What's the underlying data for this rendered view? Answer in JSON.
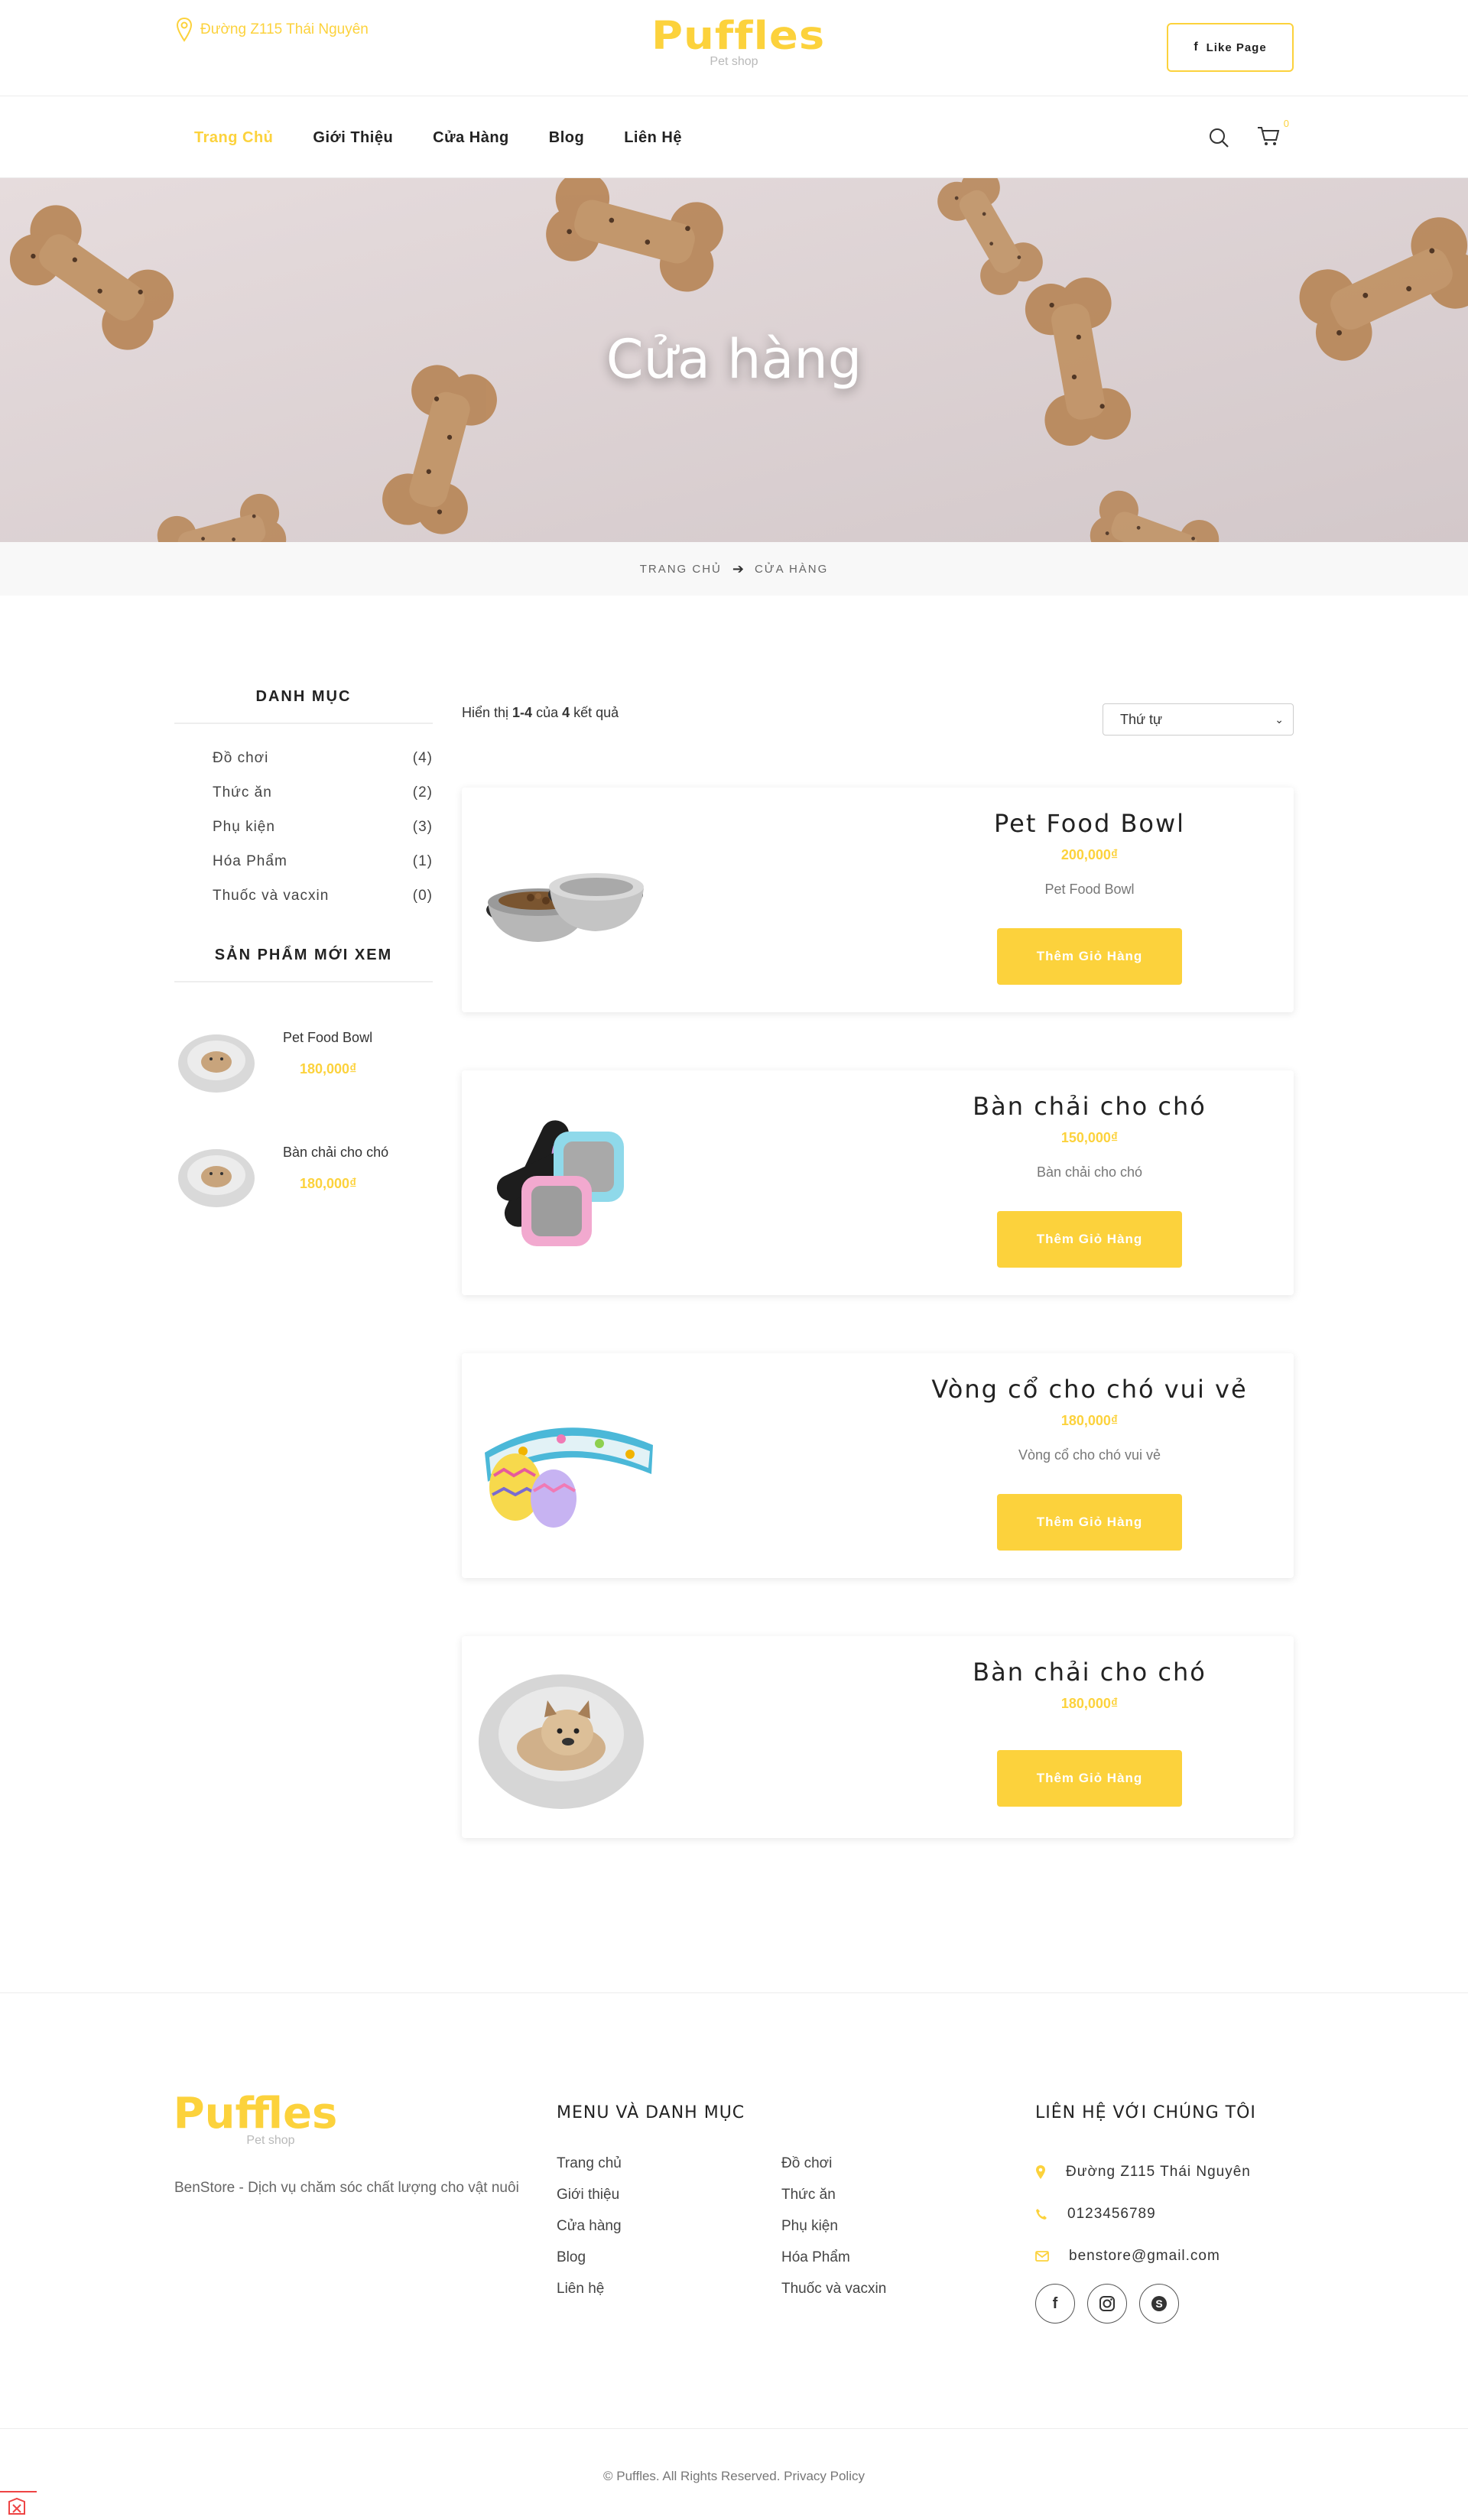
{
  "header": {
    "address": "Đường Z115 Thái Nguyên",
    "logo_text": "Puffles",
    "logo_sub": "Pet shop",
    "like_label": "Like Page"
  },
  "nav": {
    "items": [
      {
        "label": "Trang Chủ",
        "active": true
      },
      {
        "label": "Giới Thiệu",
        "active": false
      },
      {
        "label": "Cửa Hàng",
        "active": false
      },
      {
        "label": "Blog",
        "active": false
      },
      {
        "label": "Liên Hệ",
        "active": false
      }
    ],
    "cart_count": "0"
  },
  "hero": {
    "title": "Cửa hàng"
  },
  "breadcrumb": {
    "home": "TRANG CHỦ",
    "current": "CỬA HÀNG"
  },
  "sidebar": {
    "categories_title": "DANH MỤC",
    "categories": [
      {
        "name": "Đồ chơi",
        "count": "(4)"
      },
      {
        "name": "Thức ăn",
        "count": "(2)"
      },
      {
        "name": "Phụ kiện",
        "count": "(3)"
      },
      {
        "name": "Hóa Phẩm",
        "count": "(1)"
      },
      {
        "name": "Thuốc và vacxin",
        "count": "(0)"
      }
    ],
    "recent_title": "SẢN PHẨM MỚI XEM",
    "recent": [
      {
        "name": "Pet Food Bowl",
        "price": "180,000₫"
      },
      {
        "name": "Bàn chải cho chó",
        "price": "180,000₫"
      }
    ]
  },
  "shop": {
    "result_prefix": "Hiển thị ",
    "result_range": "1-4",
    "result_mid": " của ",
    "result_total": "4",
    "result_suffix": " kết quả",
    "sort_label": "Thứ tự",
    "add_label": "Thêm Giỏ Hàng",
    "products": [
      {
        "name": "Pet Food Bowl",
        "price": "200,000₫",
        "desc": "Pet Food Bowl",
        "image": "food-bowl"
      },
      {
        "name": "Bàn chải cho chó",
        "price": "150,000₫",
        "desc": "Bàn chải cho chó",
        "image": "brush"
      },
      {
        "name": "Vòng cổ cho chó vui vẻ",
        "price": "180,000₫",
        "desc": "Vòng cổ cho chó vui vẻ",
        "image": "collar"
      },
      {
        "name": "Bàn chải cho chó",
        "price": "180,000₫",
        "desc": "",
        "image": "pet-bed"
      }
    ]
  },
  "footer": {
    "logo_text": "Puffles",
    "logo_sub": "Pet shop",
    "tagline": "BenStore - Dịch vụ chăm sóc chất lượng cho vật nuôi",
    "menu_title": "MENU VÀ DANH MỤC",
    "menu_links": [
      "Trang chủ",
      "Giới thiệu",
      "Cửa hàng",
      "Blog",
      "Liên hệ"
    ],
    "category_links": [
      "Đồ chơi",
      "Thức ăn",
      "Phụ kiện",
      "Hóa Phẩm",
      "Thuốc và vacxin"
    ],
    "contact_title": "LIÊN HỆ VỚI CHÚNG TÔI",
    "address": "Đường Z115 Thái Nguyên",
    "phone": "0123456789",
    "email": "benstore@gmail.com",
    "copyright": "©  Puffles. All Rights Reserved. Privacy Policy"
  },
  "colors": {
    "accent": "#fcd23c",
    "text": "#222222",
    "muted": "#777777",
    "hero_bg": "#ddd4d4"
  }
}
